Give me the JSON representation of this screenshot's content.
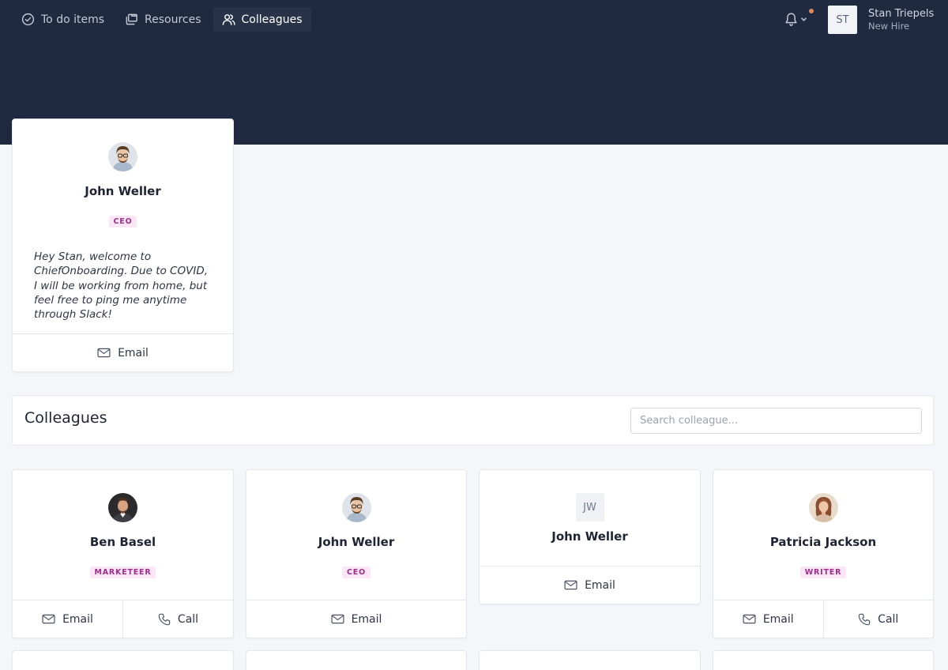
{
  "nav": {
    "items": [
      {
        "label": "To do items",
        "icon": "check-circle-icon"
      },
      {
        "label": "Resources",
        "icon": "folders-icon"
      },
      {
        "label": "Colleagues",
        "icon": "users-icon",
        "active": true
      }
    ]
  },
  "user": {
    "initials": "ST",
    "name": "Stan Triepels",
    "role": "New Hire"
  },
  "welcome": {
    "name": "John Weller",
    "badge": "CEO",
    "message": "Hey Stan, welcome to ChiefOnboarding. Due to COVID, I will be working from home, but feel free to ping me anytime through Slack!",
    "email_label": "Email"
  },
  "colleagues_panel": {
    "title": "Colleagues",
    "search_placeholder": "Search colleague..."
  },
  "colleagues": [
    {
      "name": "Ben Basel",
      "badge": "MARKETEER",
      "email_label": "Email",
      "call_label": "Call"
    },
    {
      "name": "John Weller",
      "badge": "CEO",
      "email_label": "Email"
    },
    {
      "name": "John Weller",
      "initials": "JW",
      "email_label": "Email"
    },
    {
      "name": "Patricia Jackson",
      "badge": "WRITER",
      "email_label": "Email",
      "call_label": "Call"
    }
  ],
  "colors": {
    "header": "#1f2940",
    "background": "#f4f6fa",
    "badge_bg": "#fbe6f5",
    "badge_text": "#9b2f8a",
    "notification_dot": "#d98a5d"
  }
}
